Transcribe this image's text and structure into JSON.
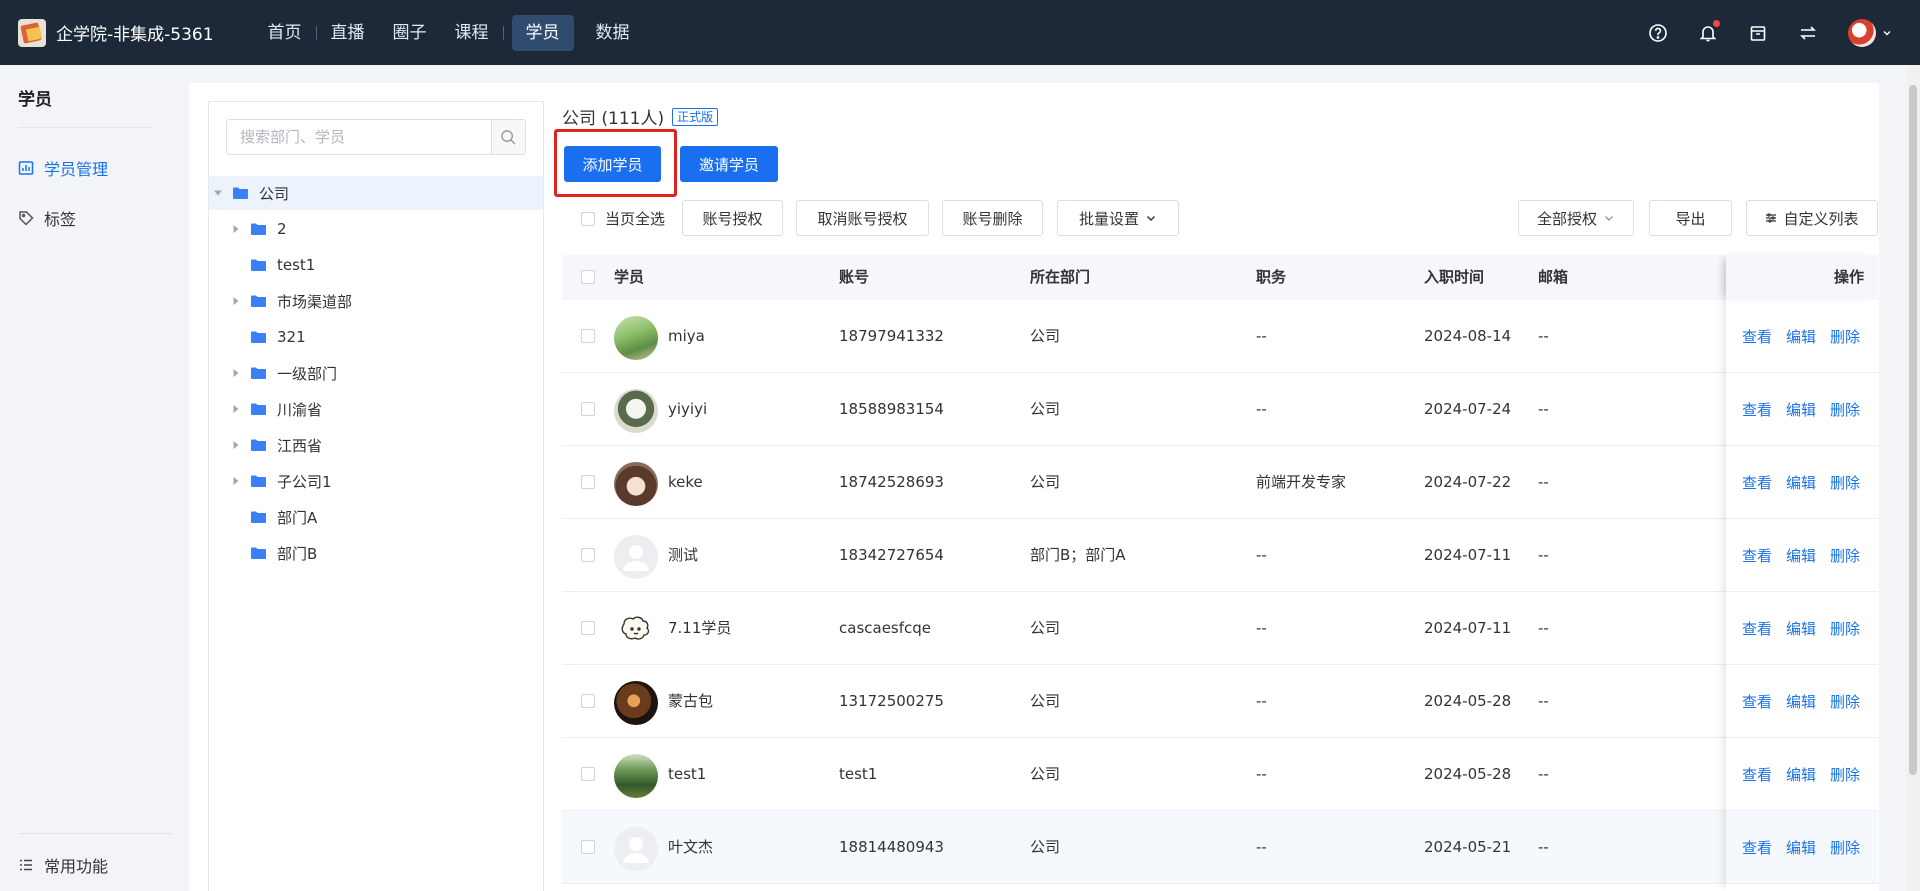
{
  "app": {
    "title": "企学院-非集成-5361"
  },
  "nav": {
    "items": [
      {
        "label": "首页"
      },
      {
        "label": "直播"
      },
      {
        "label": "圈子"
      },
      {
        "label": "课程"
      },
      {
        "label": "学员",
        "active": true
      },
      {
        "label": "数据"
      }
    ]
  },
  "top_icons": [
    "help-icon",
    "bell-icon",
    "store-icon",
    "switch-icon",
    "user-avatar"
  ],
  "sidebar": {
    "title": "学员",
    "items": [
      {
        "label": "学员管理",
        "icon": "chart-icon",
        "active": true
      },
      {
        "label": "标签",
        "icon": "tag-icon"
      }
    ],
    "bottom": {
      "label": "常用功能",
      "icon": "list-icon"
    }
  },
  "tree": {
    "search_placeholder": "搜索部门、学员",
    "root": "公司",
    "children": [
      {
        "label": "2",
        "expandable": true
      },
      {
        "label": "test1",
        "expandable": false
      },
      {
        "label": "市场渠道部",
        "expandable": true
      },
      {
        "label": "321",
        "expandable": false
      },
      {
        "label": "一级部门",
        "expandable": true
      },
      {
        "label": "川渝省",
        "expandable": true
      },
      {
        "label": "江西省",
        "expandable": true
      },
      {
        "label": "子公司1",
        "expandable": true
      },
      {
        "label": "部门A",
        "expandable": false
      },
      {
        "label": "部门B",
        "expandable": false
      }
    ]
  },
  "content": {
    "title": "公司 (111人)",
    "badge": "正式版",
    "add_button": "添加学员",
    "invite_button": "邀请学员",
    "select_all": "当页全选",
    "actions": {
      "authorize": "账号授权",
      "cancel_authorize": "取消账号授权",
      "delete": "账号删除",
      "batch": "批量设置",
      "all_auth": "全部授权",
      "export": "导出",
      "custom_list": "自定义列表"
    }
  },
  "table": {
    "headers": {
      "student": "学员",
      "account": "账号",
      "department": "所在部门",
      "position": "职务",
      "join_date": "入职时间",
      "email": "邮箱",
      "operations": "操作"
    },
    "op_labels": {
      "view": "查看",
      "edit": "编辑",
      "delete": "删除"
    },
    "rows": [
      {
        "name": "miya",
        "account": "18797941332",
        "department": "公司",
        "position": "--",
        "join_date": "2024-08-14",
        "email": "--",
        "avatar": "landscape-green"
      },
      {
        "name": "yiyiyi",
        "account": "18588983154",
        "department": "公司",
        "position": "--",
        "join_date": "2024-07-24",
        "email": "--",
        "avatar": "sketch"
      },
      {
        "name": "keke",
        "account": "18742528693",
        "department": "公司",
        "position": "前端开发专家",
        "join_date": "2024-07-22",
        "email": "--",
        "avatar": "cartoon-girl"
      },
      {
        "name": "测试",
        "account": "18342727654",
        "department": "部门B；部门A",
        "position": "--",
        "join_date": "2024-07-11",
        "email": "--",
        "avatar": "default"
      },
      {
        "name": "7.11学员",
        "account": "cascaesfcqe",
        "department": "公司",
        "position": "--",
        "join_date": "2024-07-11",
        "email": "--",
        "avatar": "dog-doodle"
      },
      {
        "name": "蒙古包",
        "account": "13172500275",
        "department": "公司",
        "position": "--",
        "join_date": "2024-05-28",
        "email": "--",
        "avatar": "dark-warm"
      },
      {
        "name": "test1",
        "account": "test1",
        "department": "公司",
        "position": "--",
        "join_date": "2024-05-28",
        "email": "--",
        "avatar": "forest"
      },
      {
        "name": "叶文杰",
        "account": "18814480943",
        "department": "公司",
        "position": "--",
        "join_date": "2024-05-21",
        "email": "--",
        "avatar": "default"
      }
    ]
  },
  "colors": {
    "nav_bg": "#1d2939",
    "primary": "#1a6ff0",
    "link": "#1a73e8",
    "highlight": "#e0241b"
  }
}
